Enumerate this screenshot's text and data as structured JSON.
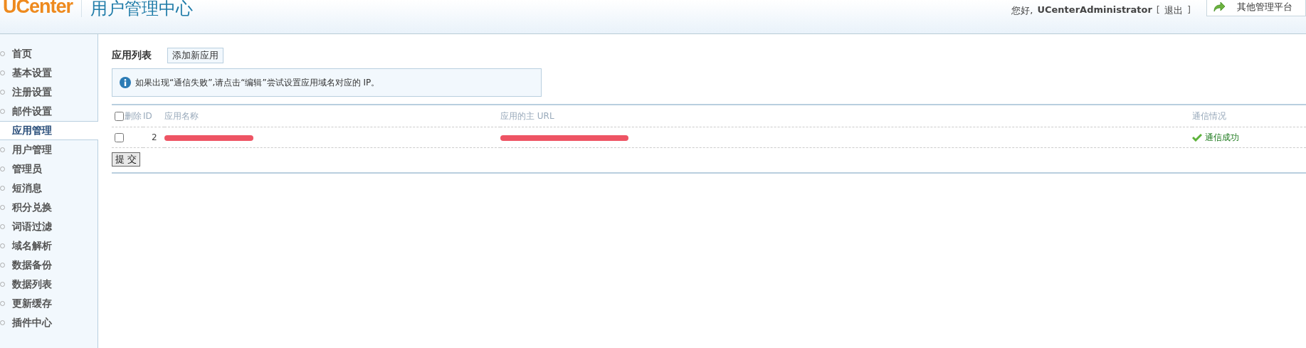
{
  "header": {
    "logo": "UCenter",
    "title": "用户管理中心",
    "greeting": "您好,",
    "username": "UCenterAdministrator",
    "logout_open": "[",
    "logout": "退出",
    "logout_close": "]",
    "platform_button": "其他管理平台"
  },
  "sidebar": {
    "items": [
      {
        "label": "首页",
        "selected": false
      },
      {
        "label": "基本设置",
        "selected": false
      },
      {
        "label": "注册设置",
        "selected": false
      },
      {
        "label": "邮件设置",
        "selected": false
      },
      {
        "label": "应用管理",
        "selected": true
      },
      {
        "label": "用户管理",
        "selected": false
      },
      {
        "label": "管理员",
        "selected": false
      },
      {
        "label": "短消息",
        "selected": false
      },
      {
        "label": "积分兑换",
        "selected": false
      },
      {
        "label": "词语过滤",
        "selected": false
      },
      {
        "label": "域名解析",
        "selected": false
      },
      {
        "label": "数据备份",
        "selected": false
      },
      {
        "label": "数据列表",
        "selected": false
      },
      {
        "label": "更新缓存",
        "selected": false
      },
      {
        "label": "插件中心",
        "selected": false
      }
    ]
  },
  "main": {
    "heading": "应用列表",
    "add_button": "添加新应用",
    "notice": "如果出现“通信失败”,请点击“编辑”尝试设置应用域名对应的 IP。",
    "table": {
      "select_all": false,
      "columns": [
        "删除",
        "ID",
        "应用名称",
        "应用的主 URL",
        "通信情况"
      ],
      "rows": [
        {
          "checked": false,
          "id": "2",
          "name_redacted": true,
          "url_redacted": true,
          "status": "通信成功"
        }
      ]
    },
    "submit": "提 交"
  }
}
